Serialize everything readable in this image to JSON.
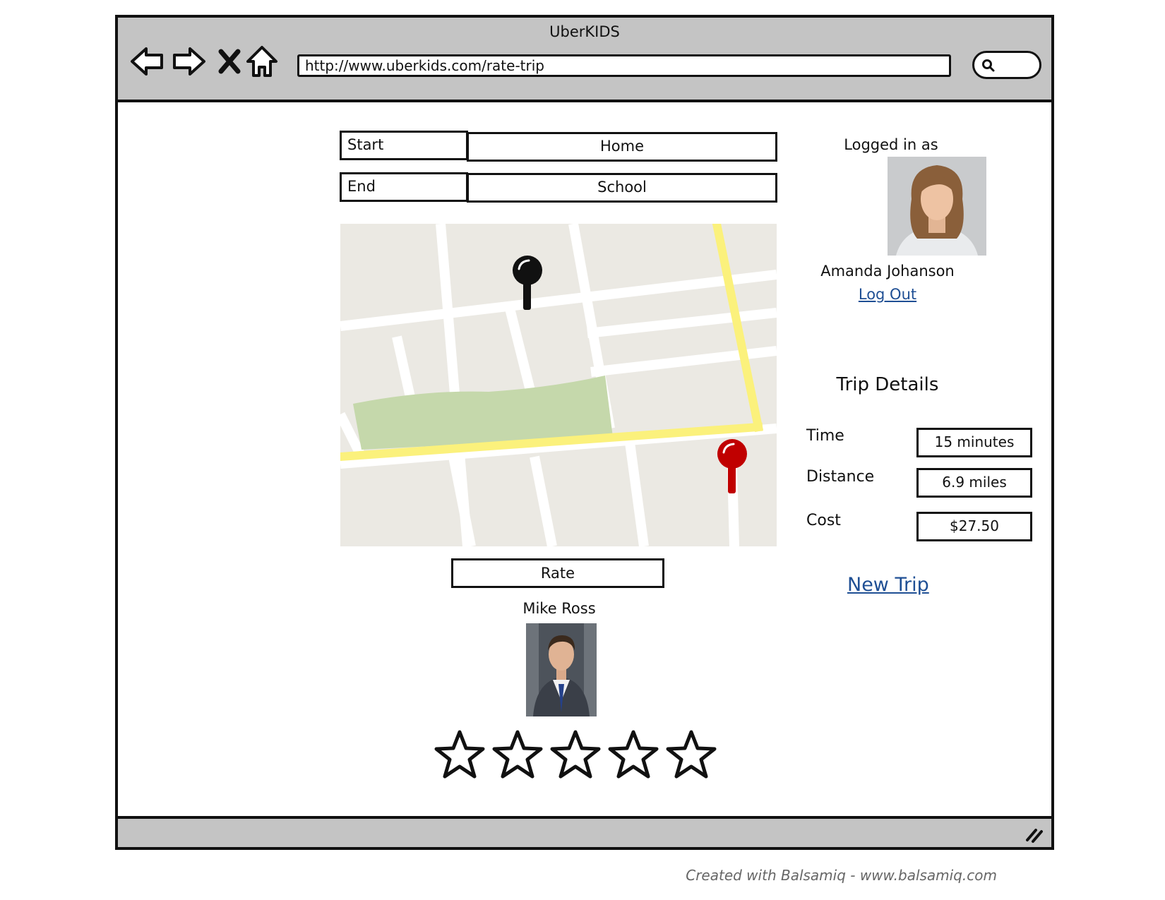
{
  "browser": {
    "title": "UberKIDS",
    "url": "http://www.uberkids.com/rate-trip",
    "icons": [
      "back-arrow-icon",
      "forward-arrow-icon",
      "close-x-icon",
      "home-icon",
      "search-icon",
      "resize-grip-icon"
    ]
  },
  "route": {
    "start_label": "Start",
    "start_value": "Home",
    "end_label": "End",
    "end_value": "School",
    "pins": [
      {
        "name": "start-pin-icon",
        "color": "#000000"
      },
      {
        "name": "end-pin-icon",
        "color": "#c00000"
      }
    ]
  },
  "rate": {
    "button_label": "Rate",
    "driver_name": "Mike Ross",
    "star_count": 5,
    "rating": 0
  },
  "user": {
    "logged_in_label": "Logged in as",
    "name": "Amanda Johanson",
    "logout_label": "Log Out"
  },
  "trip_details": {
    "heading": "Trip Details",
    "time_label": "Time",
    "time_value": "15 minutes",
    "distance_label": "Distance",
    "distance_value": "6.9 miles",
    "cost_label": "Cost",
    "cost_value": "$27.50",
    "new_trip_label": "New Trip"
  },
  "footer": {
    "credit": "Created with Balsamiq - www.balsamiq.com"
  },
  "colors": {
    "chrome": "#c4c4c4",
    "link": "#1f4f94",
    "map_road_major": "#fbf17c",
    "map_park": "#c5d8ab",
    "end_pin": "#c00000"
  }
}
